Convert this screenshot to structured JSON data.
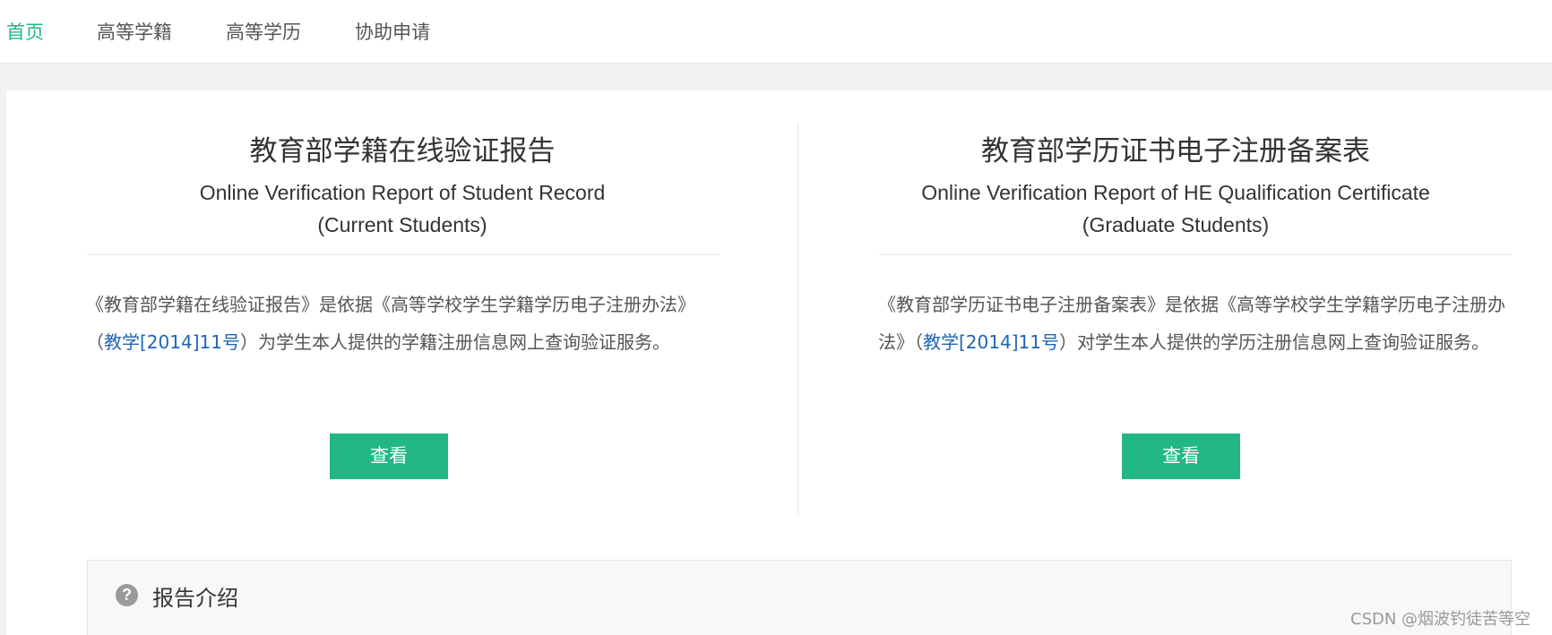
{
  "nav": {
    "items": [
      {
        "label": "首页",
        "active": true
      },
      {
        "label": "高等学籍",
        "active": false
      },
      {
        "label": "高等学历",
        "active": false
      },
      {
        "label": "协助申请",
        "active": false
      }
    ]
  },
  "cards": [
    {
      "title_cn": "教育部学籍在线验证报告",
      "title_en_line1": "Online Verification Report of Student Record",
      "title_en_line2": "(Current Students)",
      "desc_before": "《教育部学籍在线验证报告》是依据《高等学校学生学籍学历电子注册办法》（",
      "desc_link": "教学[2014]11号",
      "desc_after": "）为学生本人提供的学籍注册信息网上查询验证服务。",
      "button_label": "查看"
    },
    {
      "title_cn": "教育部学历证书电子注册备案表",
      "title_en_line1": "Online Verification Report of HE Qualification Certificate",
      "title_en_line2": "(Graduate Students)",
      "desc_before": "《教育部学历证书电子注册备案表》是依据《高等学校学生学籍学历电子注册办法》（",
      "desc_link": "教学[2014]11号",
      "desc_after": "）对学生本人提供的学历注册信息网上查询验证服务。",
      "button_label": "查看"
    }
  ],
  "intro": {
    "icon": "question-circle-icon",
    "title": "报告介绍"
  },
  "watermark": "CSDN @烟波钓徒苦等空",
  "colors": {
    "accent": "#22b784",
    "link": "#1f65b8"
  }
}
